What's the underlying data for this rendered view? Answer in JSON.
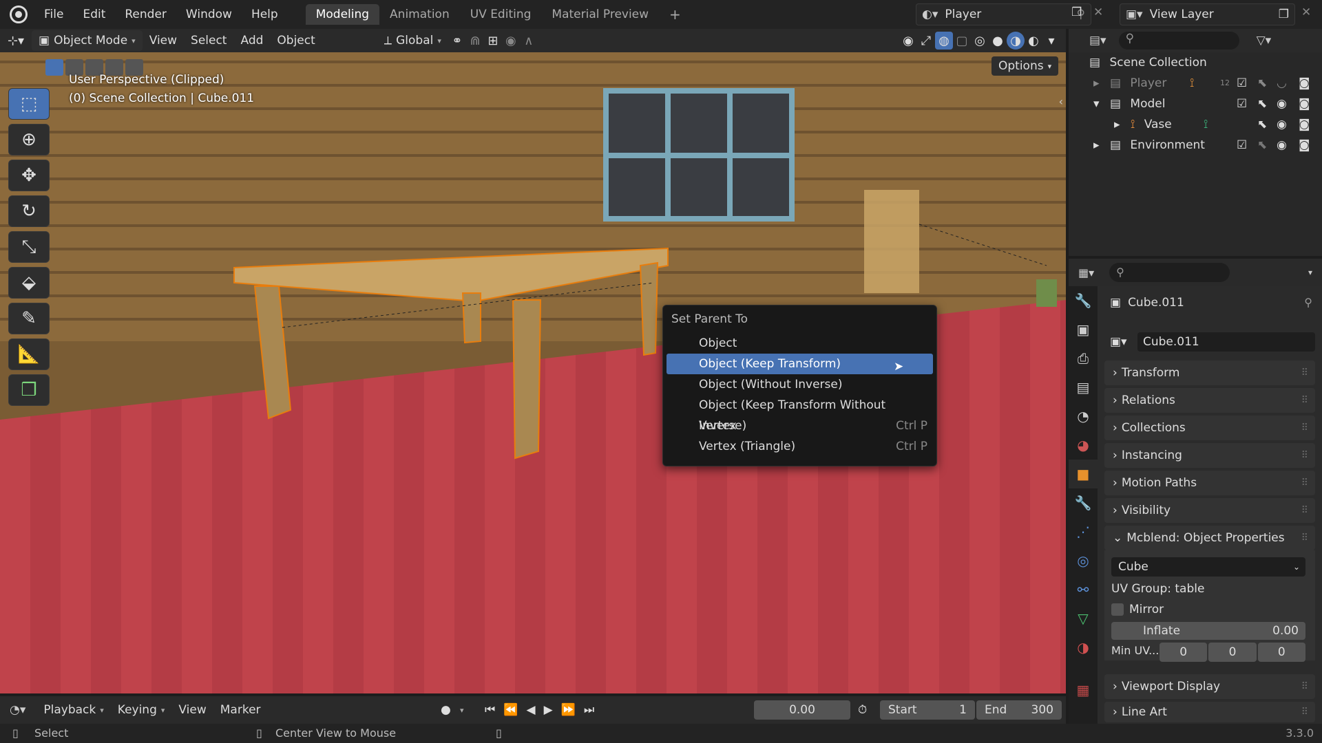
{
  "topbar": {
    "menus": [
      "File",
      "Edit",
      "Render",
      "Window",
      "Help"
    ],
    "workspaces": [
      "Modeling",
      "Animation",
      "UV Editing",
      "Material Preview"
    ],
    "active_workspace": "Modeling",
    "scene": "Player",
    "view_layer": "View Layer"
  },
  "viewport_header": {
    "mode": "Object Mode",
    "menus": [
      "View",
      "Select",
      "Add",
      "Object"
    ],
    "orientation": "Global",
    "options": "Options"
  },
  "viewport": {
    "perspective": "User Perspective (Clipped)",
    "collection": "(0) Scene Collection | Cube.011"
  },
  "context_menu": {
    "title": "Set Parent To",
    "items": [
      {
        "label": "Object",
        "shortcut": ""
      },
      {
        "label": "Object (Keep Transform)",
        "shortcut": ""
      },
      {
        "label": "Object (Without Inverse)",
        "shortcut": ""
      },
      {
        "label": "Object (Keep Transform Without Inverse)",
        "shortcut": ""
      },
      {
        "label": "Vertex",
        "shortcut": "Ctrl P"
      },
      {
        "label": "Vertex (Triangle)",
        "shortcut": "Ctrl P"
      }
    ],
    "selected_index": 1
  },
  "outliner": {
    "root": "Scene Collection",
    "rows": [
      {
        "label": "Player",
        "badge": "12"
      },
      {
        "label": "Model",
        "badge": ""
      },
      {
        "label": "Vase",
        "badge": ""
      },
      {
        "label": "Environment",
        "badge": ""
      }
    ]
  },
  "properties": {
    "object_name": "Cube.011",
    "data_name": "Cube.011",
    "panels": [
      "Transform",
      "Relations",
      "Collections",
      "Instancing",
      "Motion Paths",
      "Visibility",
      "Mcblend: Object Properties"
    ],
    "mcblend": {
      "type": "Cube",
      "uv_group": "UV Group: table",
      "mirror": "Mirror",
      "inflate_label": "Inflate",
      "inflate_value": "0.00",
      "min_uv_label": "Min UV...",
      "min_uv": [
        "0",
        "0",
        "0"
      ]
    },
    "more_panels": [
      "Viewport Display",
      "Line Art"
    ]
  },
  "timeline": {
    "menus": [
      "Playback",
      "Keying",
      "View",
      "Marker"
    ],
    "current_frame": "0.00",
    "start_label": "Start",
    "start": "1",
    "end_label": "End",
    "end": "300"
  },
  "status": {
    "left": "Select",
    "middle": "Center View to Mouse",
    "version": "3.3.0"
  },
  "colors": {
    "accent": "#4772b3",
    "selection_outline": "#e87d0d"
  }
}
